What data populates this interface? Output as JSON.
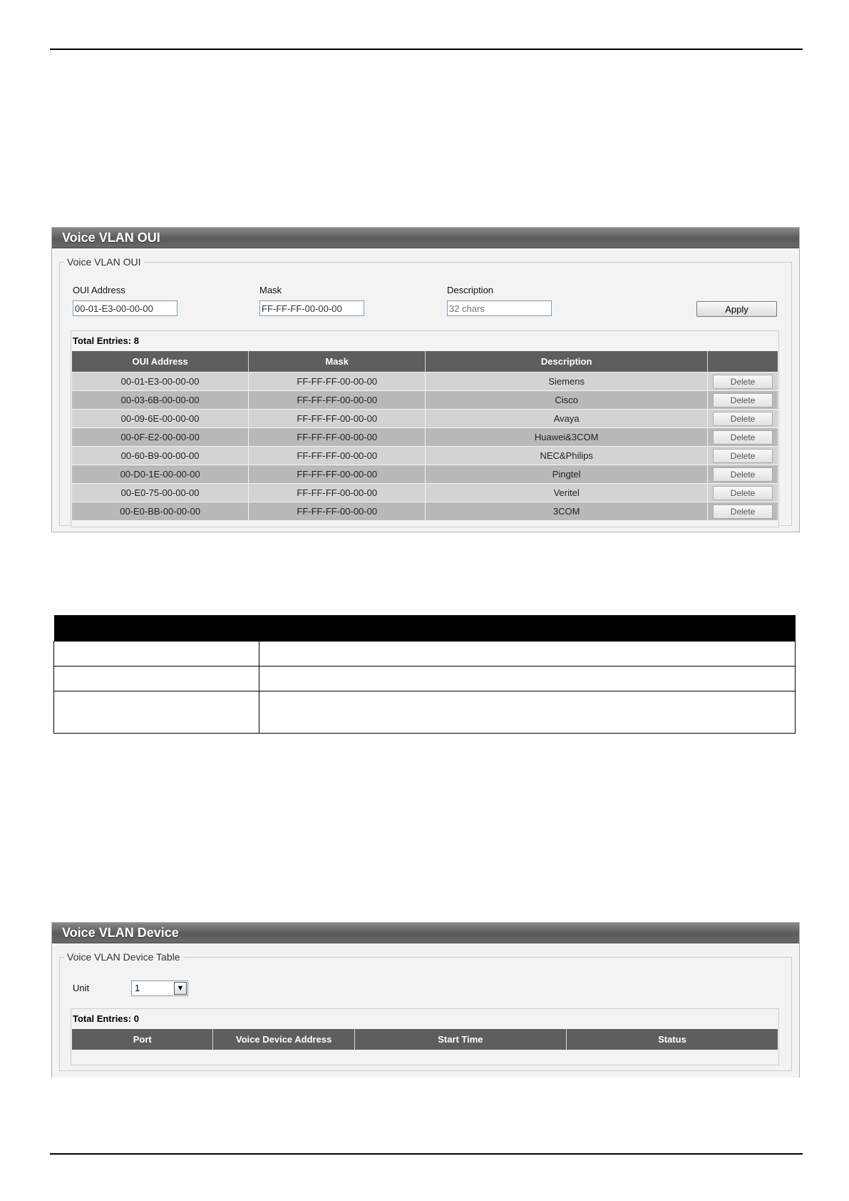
{
  "oui_panel": {
    "title": "Voice VLAN OUI",
    "legend": "Voice VLAN OUI",
    "form": {
      "oui_label": "OUI Address",
      "oui_value": "00-01-E3-00-00-00",
      "mask_label": "Mask",
      "mask_value": "FF-FF-FF-00-00-00",
      "desc_label": "Description",
      "desc_placeholder": "32 chars",
      "apply_label": "Apply"
    },
    "total_entries": "Total Entries: 8",
    "columns": [
      "OUI Address",
      "Mask",
      "Description",
      ""
    ],
    "delete_label": "Delete",
    "rows": [
      {
        "oui": "00-01-E3-00-00-00",
        "mask": "FF-FF-FF-00-00-00",
        "desc": "Siemens"
      },
      {
        "oui": "00-03-6B-00-00-00",
        "mask": "FF-FF-FF-00-00-00",
        "desc": "Cisco"
      },
      {
        "oui": "00-09-6E-00-00-00",
        "mask": "FF-FF-FF-00-00-00",
        "desc": "Avaya"
      },
      {
        "oui": "00-0F-E2-00-00-00",
        "mask": "FF-FF-FF-00-00-00",
        "desc": "Huawei&3COM"
      },
      {
        "oui": "00-60-B9-00-00-00",
        "mask": "FF-FF-FF-00-00-00",
        "desc": "NEC&Philips"
      },
      {
        "oui": "00-D0-1E-00-00-00",
        "mask": "FF-FF-FF-00-00-00",
        "desc": "Pingtel"
      },
      {
        "oui": "00-E0-75-00-00-00",
        "mask": "FF-FF-FF-00-00-00",
        "desc": "Veritel"
      },
      {
        "oui": "00-E0-BB-00-00-00",
        "mask": "FF-FF-FF-00-00-00",
        "desc": "3COM"
      }
    ]
  },
  "device_panel": {
    "title": "Voice VLAN Device",
    "legend": "Voice VLAN Device Table",
    "unit_label": "Unit",
    "unit_value": "1",
    "total_entries": "Total Entries: 0",
    "columns": [
      "Port",
      "Voice Device Address",
      "Start Time",
      "Status"
    ]
  },
  "colors": {
    "header_gradient": "#5e5e5e",
    "row_odd": "#d3d3d3",
    "row_even": "#b9b9b9"
  }
}
